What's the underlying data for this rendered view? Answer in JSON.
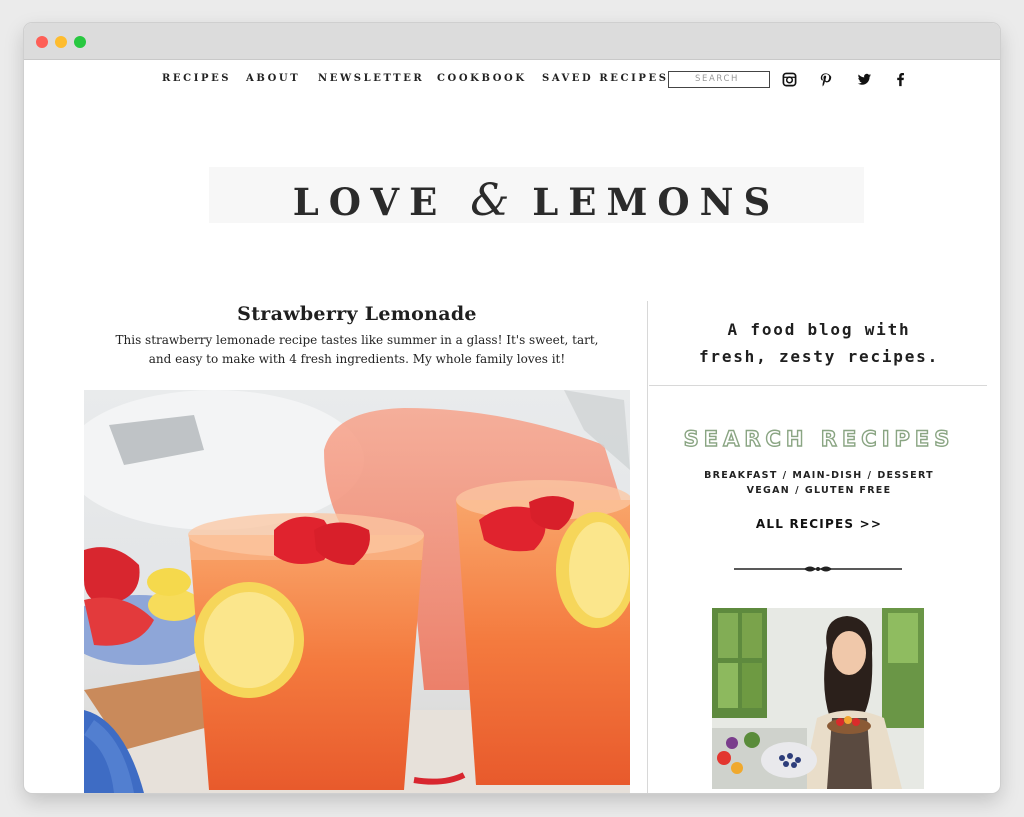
{
  "nav": {
    "links": [
      "RECIPES",
      "ABOUT",
      "NEWSLETTER",
      "COOKBOOK",
      "SAVED RECIPES"
    ],
    "search_placeholder": "SEARCH",
    "social_icons": [
      "instagram-icon",
      "pinterest-icon",
      "twitter-icon",
      "facebook-icon"
    ]
  },
  "logo": {
    "part1": "LOVE",
    "ampersand": "&",
    "part2": "LEMONS"
  },
  "post": {
    "title": "Strawberry Lemonade",
    "description": "This strawberry lemonade recipe tastes like summer in a glass! It's sweet, tart, and easy to make with 4 fresh ingredients. My whole family loves it!"
  },
  "sidebar": {
    "tagline_line1": "A food blog with",
    "tagline_line2": "fresh, zesty recipes.",
    "search_heading": "SEARCH RECIPES",
    "categories_row1": [
      "BREAKFAST",
      "MAIN-DISH",
      "DESSERT"
    ],
    "categories_row2": [
      "VEGAN",
      "GLUTEN FREE"
    ],
    "separator": "/",
    "all_recipes": "ALL RECIPES >>"
  },
  "colors": {
    "search_heading_green": "#8aa583",
    "text": "#222222",
    "lemonade_orange": "#f4773f"
  }
}
